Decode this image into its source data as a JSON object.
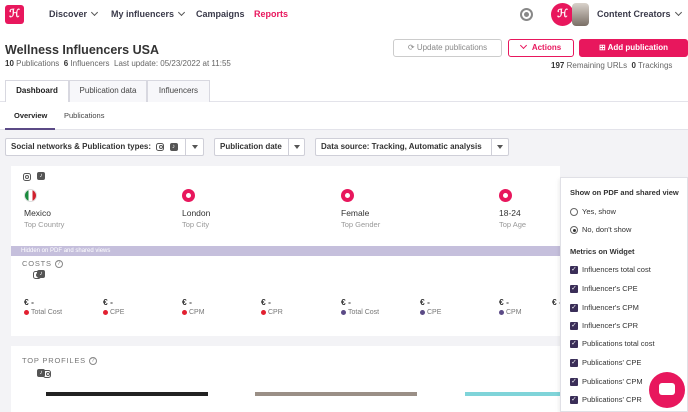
{
  "nav": {
    "logo": "ℋ",
    "items": [
      {
        "label": "Discover",
        "dropdown": true
      },
      {
        "label": "My influencers",
        "dropdown": true
      },
      {
        "label": "Campaigns",
        "dropdown": false
      },
      {
        "label": "Reports",
        "dropdown": false,
        "active": true
      }
    ],
    "account_label": "Content Creators",
    "brand_mark": "ℋ"
  },
  "header": {
    "title": "Wellness Influencers USA",
    "publications_count": "10",
    "publications_label": "Publications",
    "influencers_count": "6",
    "influencers_label": "Influencers",
    "last_update": "Last update: 05/23/2022 at 11:55",
    "update_button": "Update publications",
    "actions_button": "Actions",
    "add_button": "Add publication",
    "remaining_count": "197",
    "remaining_label": "Remaining URLs",
    "trackings_count": "0",
    "trackings_label": "Trackings"
  },
  "tabs": [
    "Dashboard",
    "Publication data",
    "Influencers"
  ],
  "subtabs": [
    "Overview",
    "Publications"
  ],
  "filters": {
    "social": "Social networks & Publication types:",
    "date": "Publication date",
    "source": "Data source:  Tracking, Automatic analysis"
  },
  "audience": [
    {
      "value": "Mexico",
      "label": "Top Country",
      "icon": "mexico-flag-icon"
    },
    {
      "value": "London",
      "label": "Top City",
      "icon": "location-pin-icon"
    },
    {
      "value": "Female",
      "label": "Top Gender",
      "icon": "female-icon"
    },
    {
      "value": "18-24",
      "label": "Top Age",
      "icon": "target-icon"
    }
  ],
  "hidden_bar": "Hidden on PDF and shared views",
  "costs": {
    "title": "COSTS",
    "items": [
      {
        "value": "€ -",
        "label": "Total Cost",
        "color": "red"
      },
      {
        "value": "€ -",
        "label": "CPE",
        "color": "red"
      },
      {
        "value": "€ -",
        "label": "CPM",
        "color": "red"
      },
      {
        "value": "€ -",
        "label": "CPR",
        "color": "red"
      },
      {
        "value": "€ -",
        "label": "Total Cost",
        "color": "purple"
      },
      {
        "value": "€ -",
        "label": "CPE",
        "color": "purple"
      },
      {
        "value": "€ -",
        "label": "CPM",
        "color": "purple"
      },
      {
        "value": "€ -",
        "label": "",
        "color": ""
      }
    ]
  },
  "top_profiles": {
    "title": "TOP PROFILES"
  },
  "panel": {
    "show_title": "Show on PDF and shared view",
    "yes_label": "Yes, show",
    "no_label": "No, don't show",
    "metrics_title": "Metrics on Widget",
    "metrics": [
      "Influencers total cost",
      "Influencer's CPE",
      "Influencer's CPM",
      "Influencer's CPR",
      "Publications total cost",
      "Publications' CPE",
      "Publications' CPM",
      "Publications' CPR"
    ]
  },
  "colors": {
    "brand": "#e8175d",
    "purple": "#5b4a86",
    "red": "#e22030"
  }
}
